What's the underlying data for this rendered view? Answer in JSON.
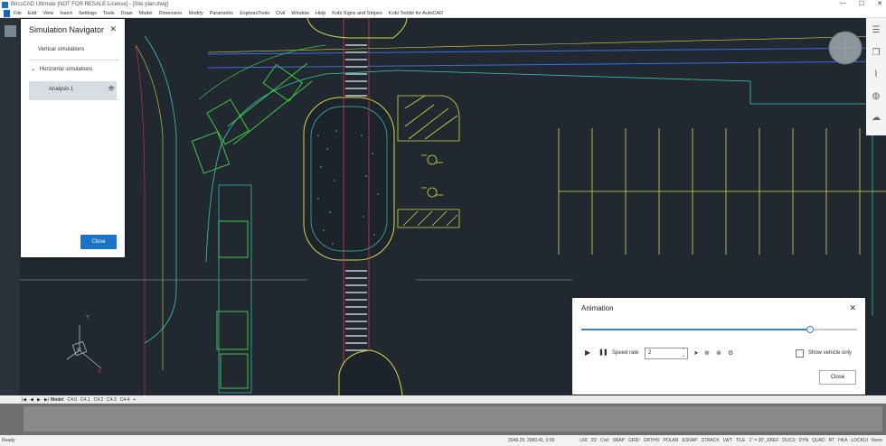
{
  "window": {
    "title": "BricsCAD Ultimate [NOT FOR RESALE License] - [Site plan.dwg]",
    "controls": [
      "—",
      "☐",
      "✕"
    ]
  },
  "menu": {
    "items": [
      "File",
      "Edit",
      "View",
      "Insert",
      "Settings",
      "Tools",
      "Draw",
      "Model",
      "Dimension",
      "Modify",
      "Parametric",
      "ExpressTools",
      "Civil",
      "Window",
      "Help",
      "Kobi Signs and Stripes",
      "Kobi Toolkit for AutoCAD"
    ]
  },
  "simulation_navigator": {
    "title": "Simulation Navigator",
    "close_glyph": "✕",
    "vertical_label": "Vertical simulations",
    "horizontal_label": "Horizontal simulations",
    "expand_glyph": "⌄",
    "analysis_label": "Analysis 1",
    "eye_glyph": "👁",
    "close_button": "Close"
  },
  "animation": {
    "title": "Animation",
    "close_glyph": "✕",
    "progress": 0.83,
    "play_glyph": "▶",
    "pause_glyph": "❚❚",
    "speed_label": "Speed rate",
    "speed_value": "2",
    "spin_up": "⌃",
    "spin_down": "⌄",
    "show_vehicle_label": "Show vehicle only",
    "show_vehicle_checked": false,
    "close_button": "Close",
    "icons": [
      "pointer-icon",
      "add-icon",
      "cancel-icon",
      "settings-icon"
    ]
  },
  "layout_tabs": {
    "nav_glyphs": [
      "|◀",
      "◀",
      "▶",
      "▶|"
    ],
    "tabs": [
      "Model",
      "C4.0",
      "C4.1",
      "C4.2",
      "C4.3",
      "C4.4",
      "+"
    ]
  },
  "status": {
    "ready": "Ready",
    "coords": "3348.29, 3080.41, 0.00",
    "toggles": [
      "L60",
      "2D",
      "Civil",
      "SNAP",
      "GRID",
      "ORTHO",
      "POLAR",
      "ESNAP",
      "STRACK",
      "LWT",
      "TILE",
      "1\" = 30'_XREF",
      "DUCS",
      "DYN",
      "QUAD",
      "RT",
      "HKA",
      "LOCKUI",
      "None"
    ]
  },
  "colors": {
    "canvas_bg": "#212830",
    "accent": "#1a73c8",
    "cad_yellow": "#d8d84a",
    "cad_cyan": "#3ac6c0",
    "cad_green": "#3fc93f",
    "cad_red": "#d23a3a",
    "cad_blue": "#3a6de0"
  }
}
